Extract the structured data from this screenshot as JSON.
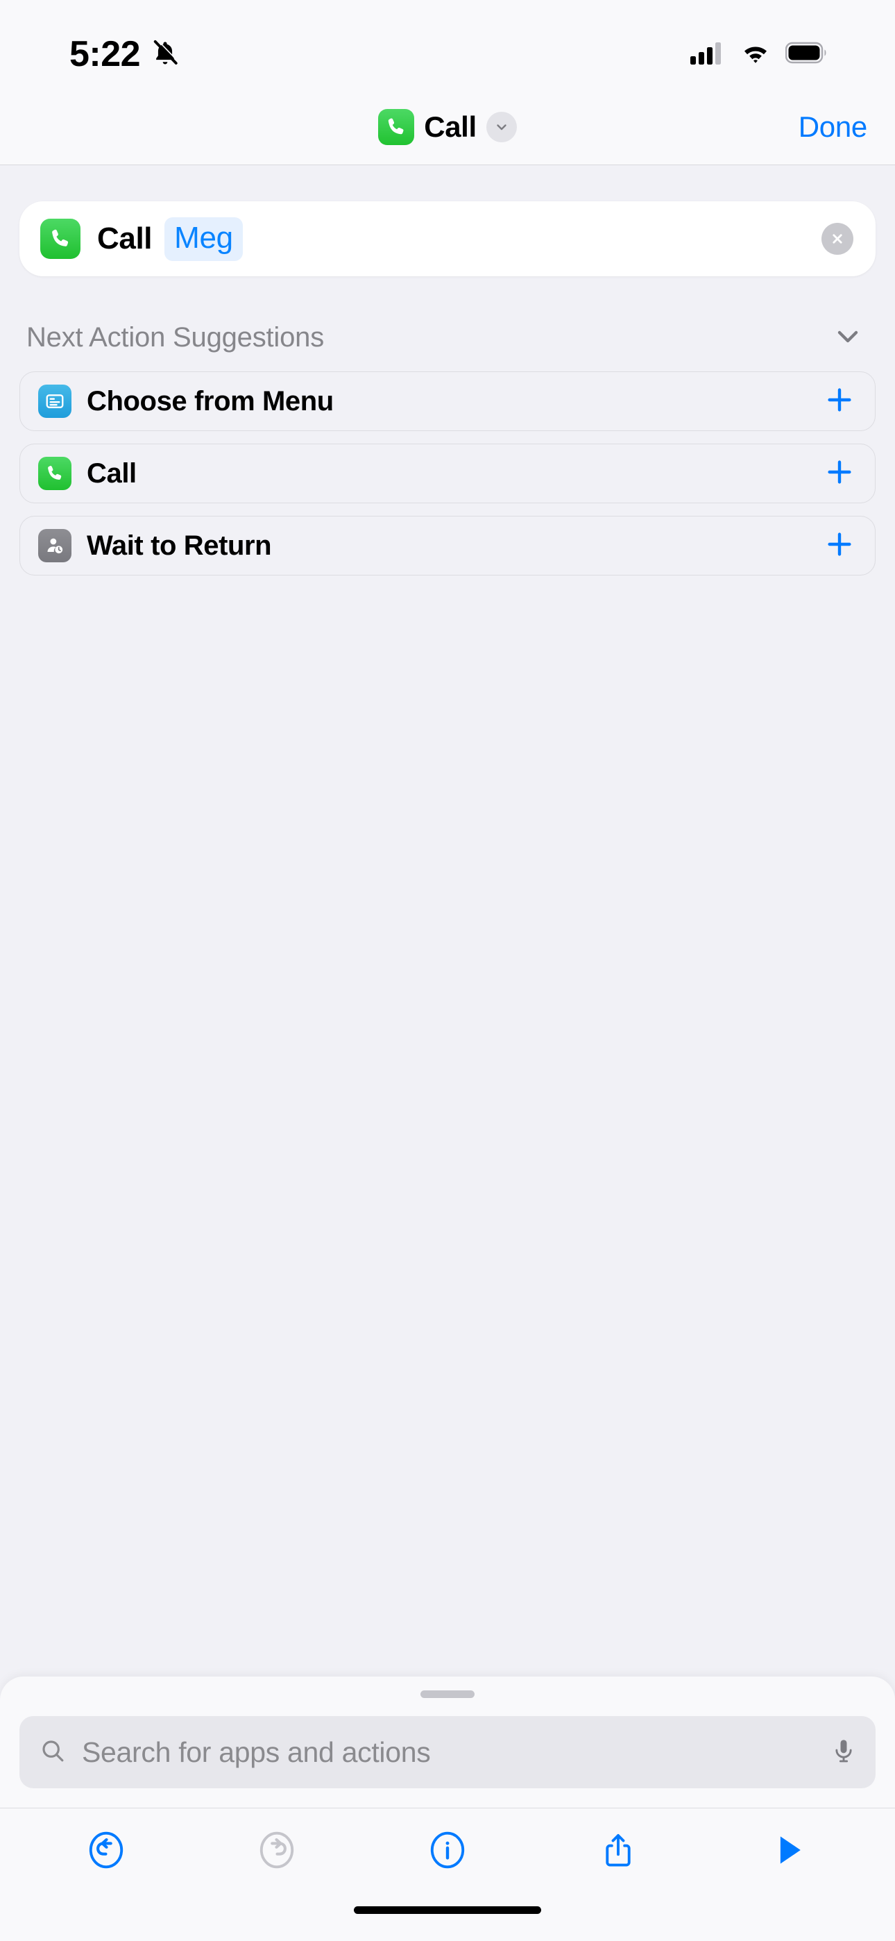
{
  "status_bar": {
    "time": "5:22",
    "icons": [
      "silent-mode-icon",
      "cellular-signal-icon",
      "wifi-icon",
      "battery-icon"
    ],
    "cellular_bars_filled": 3,
    "cellular_bars_total": 4,
    "battery_level_pct": 88
  },
  "nav_bar": {
    "app_icon": "phone-app-icon",
    "title": "Call",
    "chevron": "chevron-down-icon",
    "done_label": "Done"
  },
  "action_card": {
    "app_icon": "phone-app-icon",
    "label": "Call",
    "token": "Meg",
    "clear_icon": "close-circle-icon"
  },
  "suggestions": {
    "section_title": "Next Action Suggestions",
    "collapse_icon": "chevron-down-icon",
    "items": [
      {
        "label": "Choose from Menu",
        "icon": "menu-list-icon",
        "icon_style": "icon-menu",
        "add_icon": "plus-icon"
      },
      {
        "label": "Call",
        "icon": "phone-icon",
        "icon_style": "icon-phone",
        "add_icon": "plus-icon"
      },
      {
        "label": "Wait to Return",
        "icon": "person-clock-icon",
        "icon_style": "icon-wait",
        "add_icon": "plus-icon"
      }
    ]
  },
  "search": {
    "placeholder": "Search for apps and actions",
    "value": "",
    "search_icon": "search-icon",
    "mic_icon": "microphone-icon"
  },
  "toolbar": {
    "buttons": [
      {
        "name": "undo-button",
        "icon": "undo-icon",
        "enabled": true
      },
      {
        "name": "redo-button",
        "icon": "redo-icon",
        "enabled": false
      },
      {
        "name": "info-button",
        "icon": "info-icon",
        "enabled": true
      },
      {
        "name": "share-button",
        "icon": "share-icon",
        "enabled": true
      },
      {
        "name": "run-button",
        "icon": "play-icon",
        "enabled": true
      }
    ]
  },
  "colors": {
    "accent_blue": "#007aff",
    "token_blue": "#0a84ff",
    "token_bg": "#e5f0fe",
    "green": "#34c759",
    "gray_text": "#86868b",
    "disabled_gray": "#c5c5cb",
    "page_bg": "#f1f1f6",
    "bar_bg": "#f9f9fb"
  }
}
